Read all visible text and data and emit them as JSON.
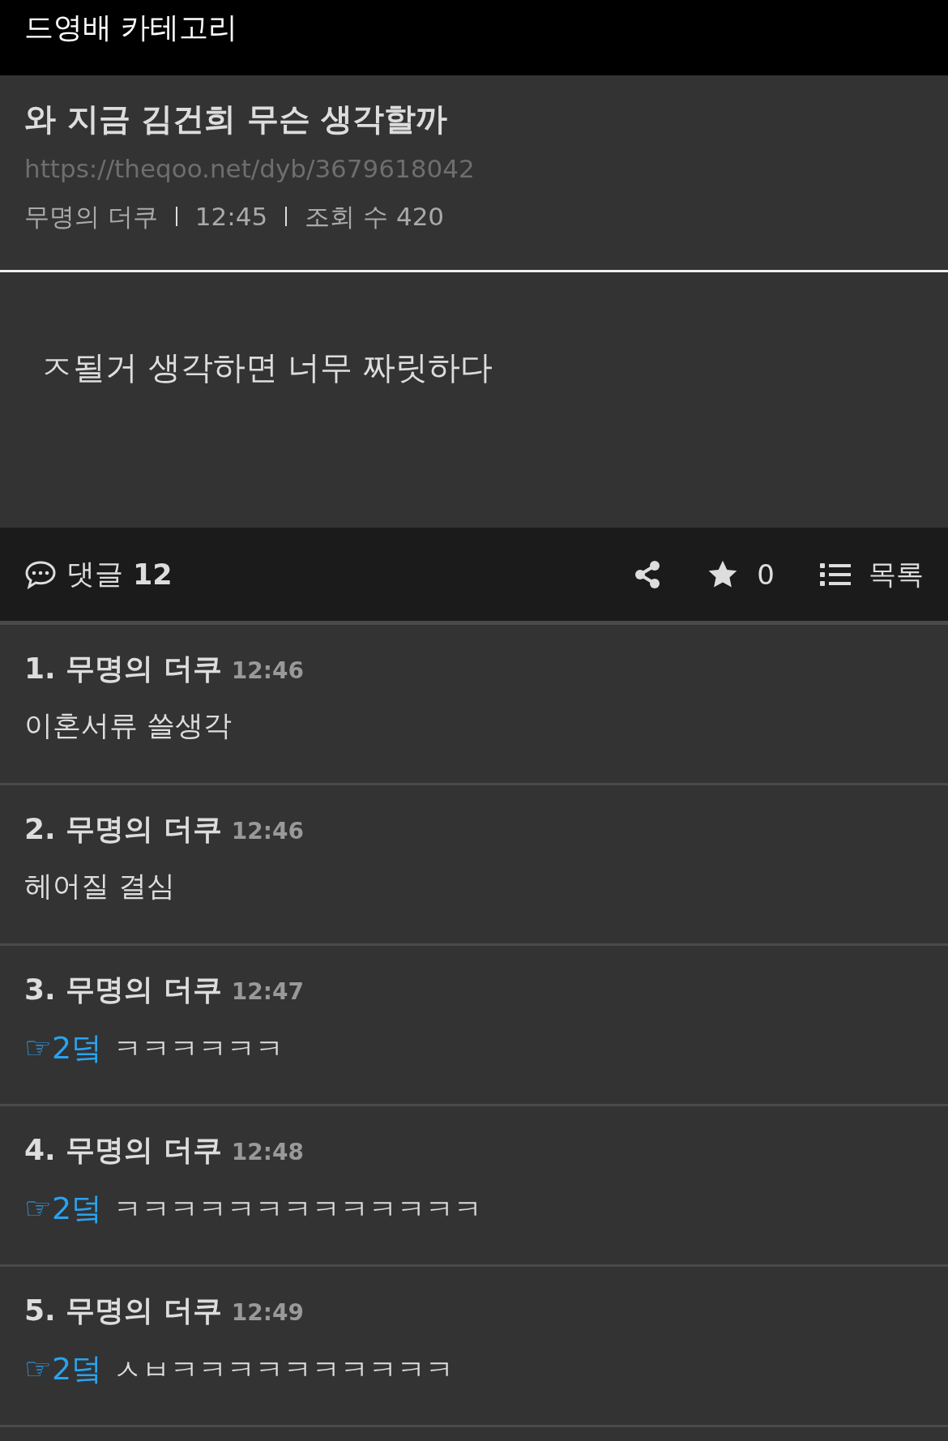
{
  "header": {
    "title": "드영배 카테고리"
  },
  "post": {
    "title": "와 지금 김건희 무슨 생각할까",
    "url": "https://theqoo.net/dyb/3679618042",
    "author": "무명의 더쿠",
    "time": "12:45",
    "views": "조회 수 420",
    "body": "ㅈ될거 생각하면 너무 짜릿하다"
  },
  "action_bar": {
    "comments_label": "댓글",
    "comments_count": "12",
    "favorites": "0",
    "list_label": "목록"
  },
  "comments": [
    {
      "number": "1.",
      "author": "무명의 더쿠",
      "time": "12:46",
      "text": "이혼서류 쓸생각"
    },
    {
      "number": "2.",
      "author": "무명의 더쿠",
      "time": "12:46",
      "text": "헤어질 결심"
    },
    {
      "number": "3.",
      "author": "무명의 더쿠",
      "time": "12:47",
      "reply_to": "☞2덬",
      "text": "ㅋㅋㅋㅋㅋㅋ"
    },
    {
      "number": "4.",
      "author": "무명의 더쿠",
      "time": "12:48",
      "reply_to": "☞2덬",
      "text": "ㅋㅋㅋㅋㅋㅋㅋㅋㅋㅋㅋㅋㅋ"
    },
    {
      "number": "5.",
      "author": "무명의 더쿠",
      "time": "12:49",
      "reply_to": "☞2덬",
      "text": "ㅅㅂㅋㅋㅋㅋㅋㅋㅋㅋㅋㅋ"
    }
  ]
}
